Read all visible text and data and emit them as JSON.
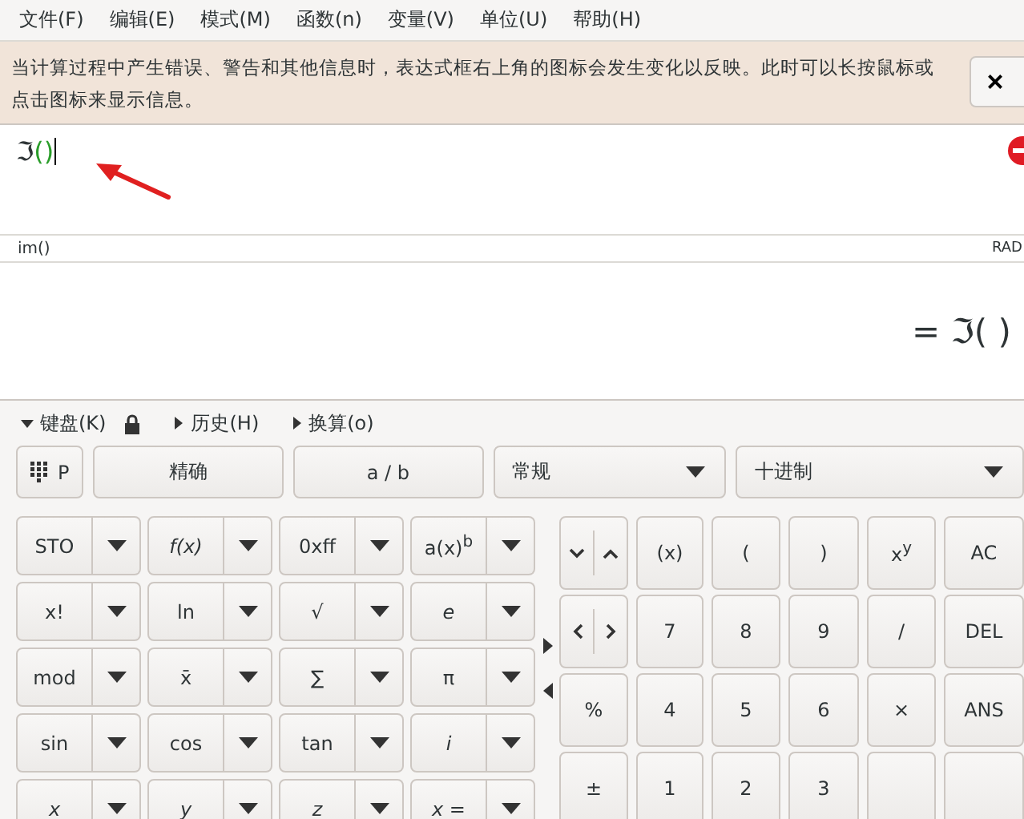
{
  "menu": [
    "文件(F)",
    "编辑(E)",
    "模式(M)",
    "函数(n)",
    "变量(V)",
    "单位(U)",
    "帮助(H)"
  ],
  "notice": {
    "text": "当计算过程中产生错误、警告和其他信息时，表达式框右上角的图标会发生变化以反映。此时可以长按鼠标或点击图标来显示信息。",
    "close": "×"
  },
  "expression": {
    "symbol": "ℑ",
    "args": "()",
    "error": true
  },
  "status": {
    "function": "im()",
    "mode": "RAD"
  },
  "result": "= ℑ( )",
  "panels": [
    {
      "label": "键盘(K)",
      "expanded": true,
      "lock": true
    },
    {
      "label": "历史(H)",
      "expanded": false,
      "lock": false
    },
    {
      "label": "换算(o)",
      "expanded": false,
      "lock": false
    }
  ],
  "keypad_toggle": "P",
  "buttons": [
    "精确",
    "a / b"
  ],
  "dropdowns": [
    "常规",
    "十进制"
  ],
  "function_keys": [
    {
      "label": "STO",
      "italic": false
    },
    {
      "label": "f(x)",
      "italic": true
    },
    {
      "label": "0xff",
      "italic": false
    },
    {
      "label": "a(x)$^{b}$",
      "italic": false
    },
    {
      "label": "x!",
      "italic": false
    },
    {
      "label": "ln",
      "italic": false
    },
    {
      "label": "√"
    },
    {
      "label": "e",
      "italic": true
    },
    {
      "label": "mod",
      "italic": false
    },
    {
      "label": "x̄",
      "italic": false
    },
    {
      "label": "∑"
    },
    {
      "label": "π",
      "italic": false
    },
    {
      "label": "sin",
      "italic": false
    },
    {
      "label": "cos",
      "italic": false
    },
    {
      "label": "tan",
      "italic": false
    },
    {
      "label": "i",
      "italic": true
    },
    {
      "label": "x",
      "italic": true
    },
    {
      "label": "y",
      "italic": true
    },
    {
      "label": "z",
      "italic": true
    },
    {
      "label": "x =",
      "italic": true
    }
  ],
  "keys": [
    {
      "kind": "arrows-vertical"
    },
    {
      "kind": "key",
      "label": "(x)"
    },
    {
      "kind": "key",
      "label": "("
    },
    {
      "kind": "key",
      "label": ")"
    },
    {
      "kind": "key",
      "label": "x$^{y}$"
    },
    {
      "kind": "key",
      "label": "AC"
    },
    {
      "kind": "arrows-horizontal"
    },
    {
      "kind": "key",
      "label": "7"
    },
    {
      "kind": "key",
      "label": "8"
    },
    {
      "kind": "key",
      "label": "9"
    },
    {
      "kind": "key",
      "label": "∕"
    },
    {
      "kind": "key",
      "label": "DEL"
    },
    {
      "kind": "key",
      "label": "%"
    },
    {
      "kind": "key",
      "label": "4"
    },
    {
      "kind": "key",
      "label": "5"
    },
    {
      "kind": "key",
      "label": "6"
    },
    {
      "kind": "key",
      "label": "×"
    },
    {
      "kind": "key",
      "label": "ANS"
    },
    {
      "kind": "key",
      "label": "±"
    },
    {
      "kind": "key",
      "label": "1"
    },
    {
      "kind": "key",
      "label": "2"
    },
    {
      "kind": "key",
      "label": "3"
    },
    {
      "kind": "key"
    },
    {
      "kind": "key"
    }
  ]
}
